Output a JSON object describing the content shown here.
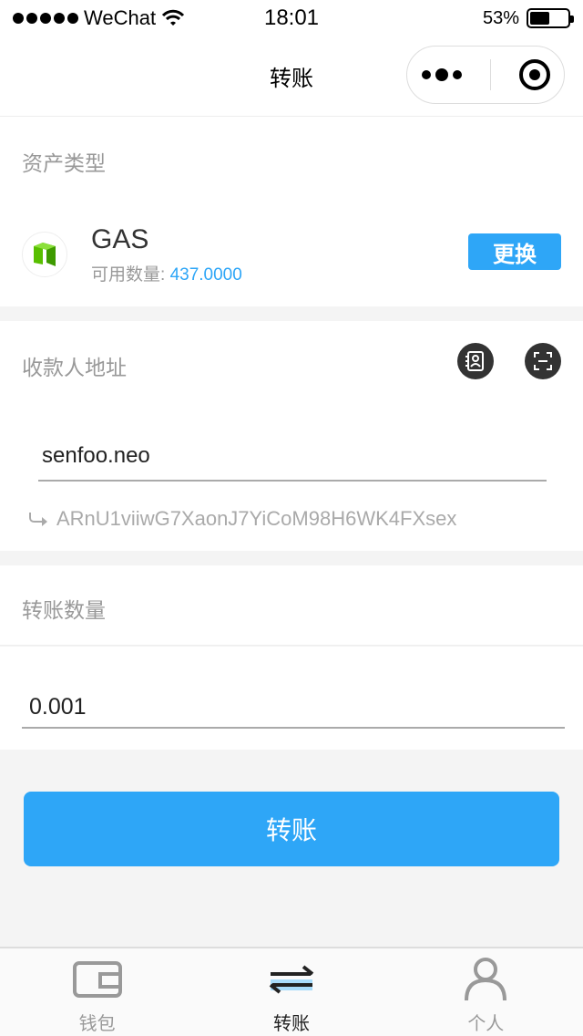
{
  "status_bar": {
    "carrier": "WeChat",
    "time": "18:01",
    "battery_percent": "53%",
    "battery_level": 0.53
  },
  "nav": {
    "title": "转账"
  },
  "asset": {
    "section_label": "资产类型",
    "name": "GAS",
    "balance_label": "可用数量: ",
    "balance_value": "437.0000",
    "change_label": "更换"
  },
  "payee": {
    "section_label": "收款人地址",
    "input_value": "senfoo.neo",
    "resolved_address": "ARnU1viiwG7XaonJ7YiCoM98H6WK4FXsex"
  },
  "amount": {
    "section_label": "转账数量",
    "input_value": "0.001"
  },
  "transfer_button_label": "转账",
  "tabs": [
    {
      "label": "钱包",
      "icon": "wallet-icon",
      "active": false
    },
    {
      "label": "转账",
      "icon": "transfer-icon",
      "active": true
    },
    {
      "label": "个人",
      "icon": "person-icon",
      "active": false
    }
  ],
  "colors": {
    "accent": "#2ea6f7",
    "neo_green": "#58bf00"
  }
}
